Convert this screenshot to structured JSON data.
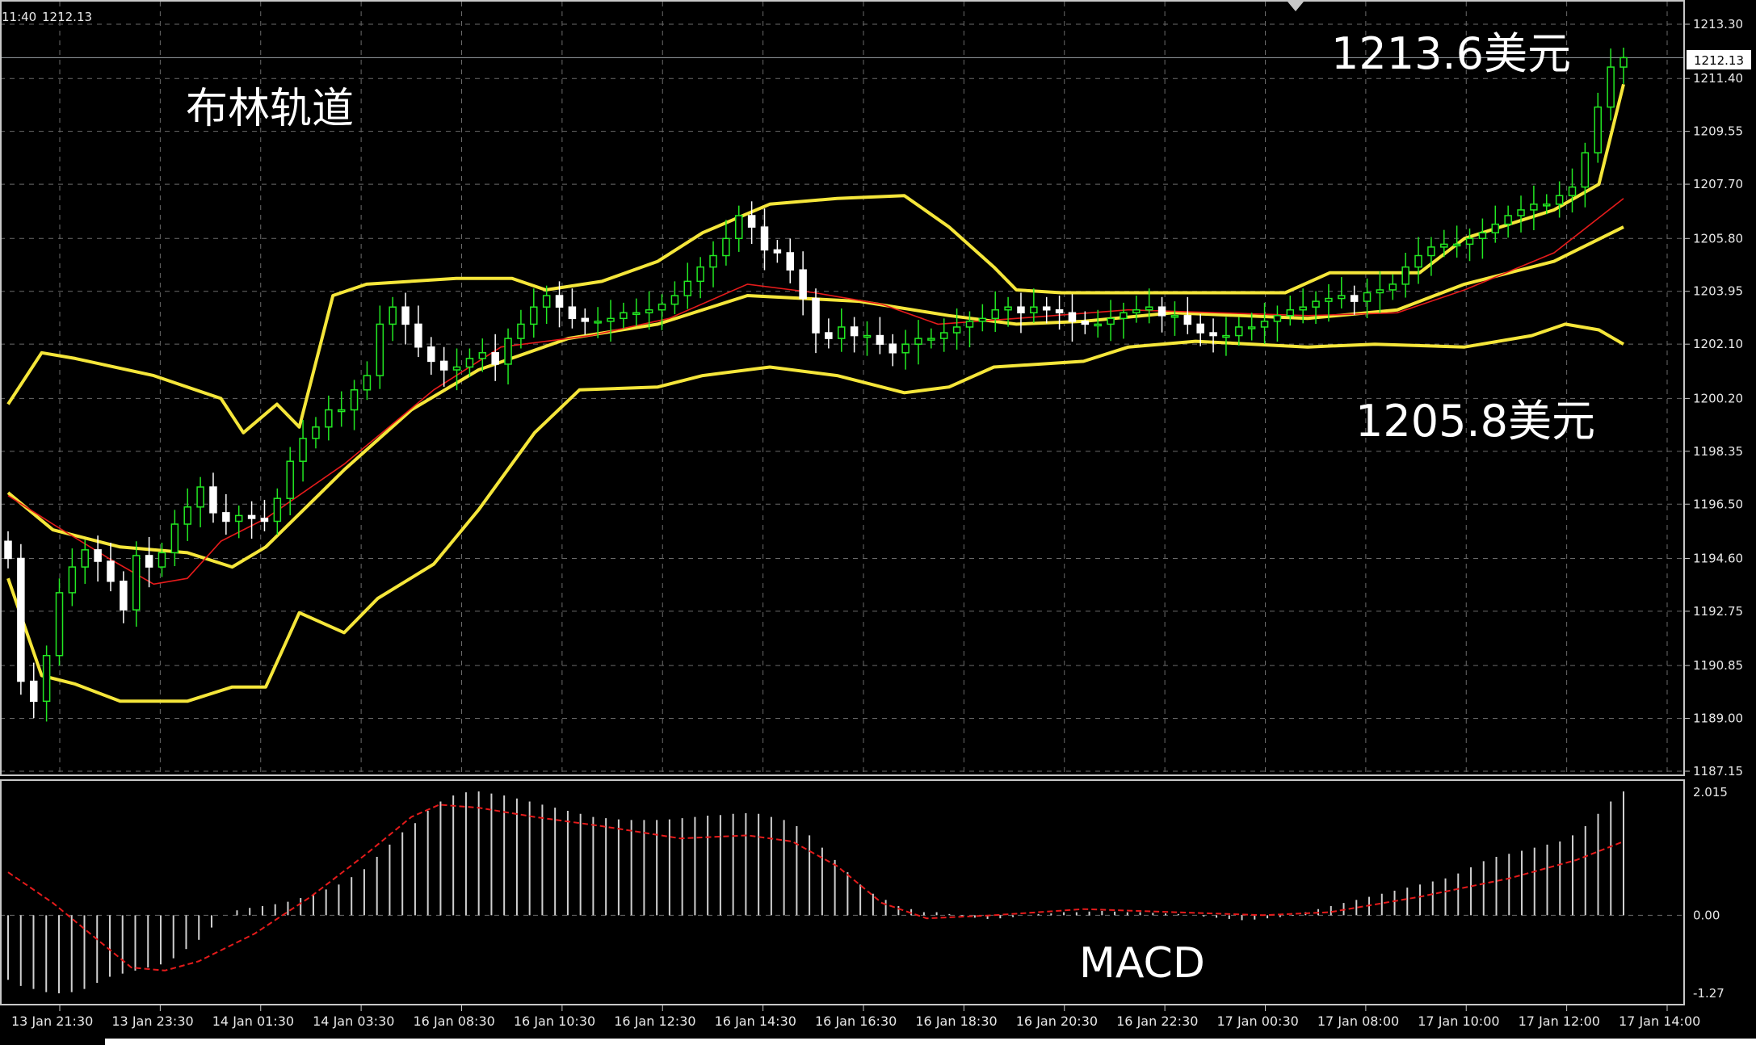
{
  "header": {
    "time": "11:40",
    "price": "1212.13"
  },
  "annotations": {
    "indicator_title": "布林轨道",
    "upper_target": "1213.6美元",
    "lower_target": "1205.8美元",
    "macd_label": "MACD"
  },
  "colors": {
    "background": "#000000",
    "grid": "#6a6a6a",
    "bull_candle": "#22e822",
    "bear_candle": "#ffffff",
    "bollinger": "#f5e63a",
    "moving_average": "#e51b1b",
    "macd_signal": "#e51b1b",
    "macd_histogram": "#d0d0d0",
    "current_price_line": "#9aa0a6"
  },
  "chart_data": [
    {
      "type": "candlestick",
      "title": "布林轨道",
      "y_ticks": [
        "1213.30",
        "1211.40",
        "1209.55",
        "1207.70",
        "1205.80",
        "1203.95",
        "1202.10",
        "1200.20",
        "1198.35",
        "1196.50",
        "1194.60",
        "1192.75",
        "1190.85",
        "1189.00",
        "1187.15"
      ],
      "ylim": [
        1187.15,
        1213.3
      ],
      "x_ticks": [
        "13 Jan 21:30",
        "13 Jan 23:30",
        "14 Jan 01:30",
        "14 Jan 03:30",
        "16 Jan 08:30",
        "16 Jan 10:30",
        "16 Jan 12:30",
        "16 Jan 14:30",
        "16 Jan 16:30",
        "16 Jan 18:30",
        "16 Jan 20:30",
        "16 Jan 22:30",
        "17 Jan 00:30",
        "17 Jan 08:00",
        "17 Jan 10:00",
        "17 Jan 12:00",
        "17 Jan 14:00"
      ],
      "current_price": 1212.13,
      "grid": true,
      "close_series": [
        1194.6,
        1190.3,
        1189.6,
        1191.2,
        1193.4,
        1194.3,
        1194.9,
        1194.5,
        1193.8,
        1192.8,
        1194.7,
        1194.3,
        1194.8,
        1195.8,
        1196.4,
        1197.1,
        1196.2,
        1195.9,
        1196.1,
        1196.0,
        1195.9,
        1196.7,
        1198.0,
        1198.8,
        1199.2,
        1199.8,
        1199.8,
        1200.5,
        1201.0,
        1202.8,
        1203.4,
        1202.8,
        1202.0,
        1201.5,
        1201.2,
        1201.3,
        1201.6,
        1201.8,
        1201.4,
        1202.3,
        1202.8,
        1203.4,
        1203.8,
        1203.4,
        1203.0,
        1202.9,
        1202.9,
        1203.0,
        1203.2,
        1203.2,
        1203.3,
        1203.5,
        1203.8,
        1204.3,
        1204.8,
        1205.2,
        1205.8,
        1206.6,
        1206.2,
        1205.4,
        1205.3,
        1204.7,
        1203.7,
        1202.5,
        1202.3,
        1202.7,
        1202.4,
        1202.4,
        1202.1,
        1201.8,
        1202.1,
        1202.3,
        1202.3,
        1202.5,
        1202.7,
        1202.9,
        1203.0,
        1203.3,
        1203.4,
        1203.2,
        1203.4,
        1203.3,
        1203.2,
        1202.9,
        1202.8,
        1202.8,
        1203.0,
        1203.2,
        1203.3,
        1203.4,
        1203.1,
        1203.1,
        1202.8,
        1202.5,
        1202.4,
        1202.4,
        1202.7,
        1202.7,
        1202.9,
        1203.1,
        1203.3,
        1203.4,
        1203.6,
        1203.7,
        1203.8,
        1203.6,
        1203.9,
        1204.0,
        1204.2,
        1204.8,
        1205.2,
        1205.5,
        1205.6,
        1205.6,
        1205.8,
        1206.0,
        1206.3,
        1206.6,
        1206.8,
        1207.0,
        1207.0,
        1207.3,
        1207.6,
        1208.8,
        1210.4,
        1211.8,
        1212.13
      ],
      "bollinger": {
        "upper": [
          [
            0,
            1200.0
          ],
          [
            30,
            1201.8
          ],
          [
            60,
            1201.6
          ],
          [
            130,
            1201.0
          ],
          [
            190,
            1200.2
          ],
          [
            210,
            1199.0
          ],
          [
            240,
            1200.0
          ],
          [
            260,
            1199.2
          ],
          [
            290,
            1203.8
          ],
          [
            320,
            1204.2
          ],
          [
            400,
            1204.4
          ],
          [
            450,
            1204.4
          ],
          [
            480,
            1204.0
          ],
          [
            530,
            1204.3
          ],
          [
            580,
            1205.0
          ],
          [
            620,
            1206.0
          ],
          [
            680,
            1207.0
          ],
          [
            740,
            1207.2
          ],
          [
            800,
            1207.3
          ],
          [
            840,
            1206.2
          ],
          [
            880,
            1204.8
          ],
          [
            900,
            1204.0
          ],
          [
            940,
            1203.9
          ],
          [
            1050,
            1203.9
          ],
          [
            1140,
            1203.9
          ],
          [
            1180,
            1204.6
          ],
          [
            1260,
            1204.6
          ],
          [
            1300,
            1205.8
          ],
          [
            1380,
            1206.8
          ],
          [
            1420,
            1207.7
          ],
          [
            1442,
            1211.2
          ]
        ],
        "middle": [
          [
            0,
            1196.9
          ],
          [
            40,
            1195.6
          ],
          [
            100,
            1195.0
          ],
          [
            160,
            1194.8
          ],
          [
            200,
            1194.3
          ],
          [
            230,
            1195.0
          ],
          [
            300,
            1197.7
          ],
          [
            360,
            1199.8
          ],
          [
            420,
            1201.2
          ],
          [
            500,
            1202.3
          ],
          [
            580,
            1202.8
          ],
          [
            660,
            1203.8
          ],
          [
            760,
            1203.6
          ],
          [
            840,
            1203.1
          ],
          [
            900,
            1202.8
          ],
          [
            960,
            1202.9
          ],
          [
            1040,
            1203.2
          ],
          [
            1160,
            1203.0
          ],
          [
            1240,
            1203.3
          ],
          [
            1300,
            1204.2
          ],
          [
            1380,
            1205.0
          ],
          [
            1442,
            1206.2
          ]
        ],
        "lower": [
          [
            0,
            1193.9
          ],
          [
            30,
            1190.5
          ],
          [
            60,
            1190.2
          ],
          [
            100,
            1189.6
          ],
          [
            160,
            1189.6
          ],
          [
            200,
            1190.1
          ],
          [
            230,
            1190.1
          ],
          [
            260,
            1192.7
          ],
          [
            300,
            1192.0
          ],
          [
            330,
            1193.2
          ],
          [
            380,
            1194.4
          ],
          [
            420,
            1196.3
          ],
          [
            470,
            1199.0
          ],
          [
            510,
            1200.5
          ],
          [
            580,
            1200.6
          ],
          [
            620,
            1201.0
          ],
          [
            680,
            1201.3
          ],
          [
            740,
            1201.0
          ],
          [
            800,
            1200.4
          ],
          [
            840,
            1200.6
          ],
          [
            880,
            1201.3
          ],
          [
            960,
            1201.5
          ],
          [
            1000,
            1202.0
          ],
          [
            1060,
            1202.2
          ],
          [
            1160,
            1202.0
          ],
          [
            1220,
            1202.1
          ],
          [
            1300,
            1202.0
          ],
          [
            1360,
            1202.4
          ],
          [
            1390,
            1202.8
          ],
          [
            1420,
            1202.6
          ],
          [
            1442,
            1202.1
          ]
        ]
      },
      "moving_average": [
        [
          0,
          1196.8
        ],
        [
          40,
          1195.8
        ],
        [
          90,
          1194.6
        ],
        [
          130,
          1193.7
        ],
        [
          160,
          1193.9
        ],
        [
          190,
          1195.2
        ],
        [
          230,
          1196.0
        ],
        [
          300,
          1197.9
        ],
        [
          380,
          1200.5
        ],
        [
          440,
          1202.0
        ],
        [
          520,
          1202.4
        ],
        [
          590,
          1203.0
        ],
        [
          660,
          1204.2
        ],
        [
          720,
          1203.9
        ],
        [
          780,
          1203.5
        ],
        [
          830,
          1202.8
        ],
        [
          900,
          1203.0
        ],
        [
          1000,
          1203.3
        ],
        [
          1080,
          1203.2
        ],
        [
          1160,
          1203.1
        ],
        [
          1240,
          1203.2
        ],
        [
          1300,
          1204.0
        ],
        [
          1380,
          1205.3
        ],
        [
          1442,
          1207.2
        ]
      ]
    },
    {
      "type": "bar",
      "title": "MACD",
      "y_ticks": [
        "2.015",
        "0.00",
        "-1.27"
      ],
      "ylim": [
        -1.27,
        2.015
      ],
      "histogram": [
        -1.05,
        -1.15,
        -1.2,
        -1.25,
        -1.27,
        -1.25,
        -1.2,
        -1.1,
        -1.0,
        -0.95,
        -0.9,
        -0.85,
        -0.8,
        -0.7,
        -0.55,
        -0.4,
        -0.2,
        0.0,
        0.08,
        0.12,
        0.15,
        0.18,
        0.22,
        0.28,
        0.34,
        0.42,
        0.5,
        0.62,
        0.75,
        0.95,
        1.15,
        1.35,
        1.5,
        1.7,
        1.85,
        1.95,
        2.0,
        2.015,
        1.98,
        1.95,
        1.9,
        1.85,
        1.8,
        1.75,
        1.7,
        1.65,
        1.6,
        1.58,
        1.56,
        1.55,
        1.55,
        1.55,
        1.56,
        1.58,
        1.6,
        1.62,
        1.63,
        1.65,
        1.66,
        1.65,
        1.6,
        1.55,
        1.45,
        1.3,
        1.1,
        0.9,
        0.7,
        0.5,
        0.35,
        0.25,
        0.15,
        0.1,
        0.05,
        0.05,
        0.02,
        -0.02,
        -0.04,
        -0.06,
        -0.05,
        -0.03,
        0.0,
        0.02,
        0.03,
        0.05,
        0.05,
        0.06,
        0.07,
        0.06,
        0.05,
        0.05,
        0.04,
        0.03,
        0.02,
        0.0,
        -0.02,
        -0.04,
        -0.06,
        -0.08,
        -0.07,
        -0.05,
        -0.03,
        -0.01,
        0.05,
        0.1,
        0.15,
        0.2,
        0.25,
        0.3,
        0.35,
        0.4,
        0.45,
        0.5,
        0.55,
        0.6,
        0.68,
        0.78,
        0.88,
        0.95,
        1.0,
        1.05,
        1.1,
        1.15,
        1.2,
        1.3,
        1.45,
        1.65,
        1.85,
        2.015
      ],
      "signal": [
        [
          0,
          0.7
        ],
        [
          40,
          0.2
        ],
        [
          80,
          -0.4
        ],
        [
          110,
          -0.85
        ],
        [
          140,
          -0.9
        ],
        [
          170,
          -0.75
        ],
        [
          220,
          -0.3
        ],
        [
          270,
          0.3
        ],
        [
          320,
          1.0
        ],
        [
          360,
          1.6
        ],
        [
          385,
          1.8
        ],
        [
          420,
          1.75
        ],
        [
          470,
          1.6
        ],
        [
          530,
          1.45
        ],
        [
          600,
          1.25
        ],
        [
          660,
          1.3
        ],
        [
          700,
          1.2
        ],
        [
          740,
          0.8
        ],
        [
          780,
          0.2
        ],
        [
          820,
          -0.05
        ],
        [
          880,
          0.0
        ],
        [
          960,
          0.1
        ],
        [
          1040,
          0.05
        ],
        [
          1120,
          0.0
        ],
        [
          1180,
          0.05
        ],
        [
          1260,
          0.3
        ],
        [
          1340,
          0.6
        ],
        [
          1400,
          0.9
        ],
        [
          1442,
          1.2
        ]
      ]
    }
  ]
}
